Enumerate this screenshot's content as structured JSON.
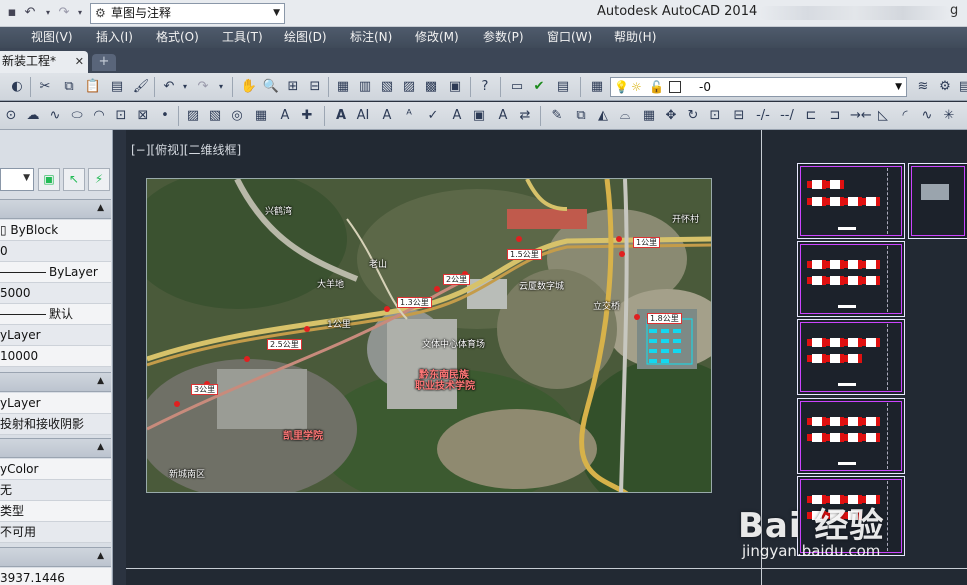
{
  "titlebar": {
    "workspace": "草图与注释",
    "app_title": "Autodesk AutoCAD 2014",
    "trailing": "g"
  },
  "menu": [
    "视图(V)",
    "插入(I)",
    "格式(O)",
    "工具(T)",
    "绘图(D)",
    "标注(N)",
    "修改(M)",
    "参数(P)",
    "窗口(W)",
    "帮助(H)"
  ],
  "tabs": {
    "active": "新装工程*",
    "new_tab_icon": "plus-icon"
  },
  "layer_control": {
    "value": "-0"
  },
  "palette": {
    "rows1": [
      "ByBlock",
      "0",
      "ByLayer",
      "5000",
      "默认",
      "yLayer",
      "10000"
    ],
    "rows2": [
      "yLayer",
      "投射和接收阴影"
    ],
    "rows3": [
      "yColor",
      "无",
      "类型",
      "不可用"
    ],
    "coord": "3937.1446"
  },
  "viewport": {
    "label": "[−][俯视][二维线框]"
  },
  "map": {
    "labels": [
      {
        "t": "兴鹤湾"
      },
      {
        "t": "老山"
      },
      {
        "t": "大羊地"
      },
      {
        "t": "1公里"
      },
      {
        "t": "云厦数字城"
      },
      {
        "t": "文体中心体育场"
      },
      {
        "t": "黔东南民族"
      },
      {
        "t": "职业技术学院"
      },
      {
        "t": "凯里学院"
      },
      {
        "t": "立交桥"
      },
      {
        "t": "开怀村"
      },
      {
        "t": "新城南区"
      }
    ],
    "tags": [
      "1公里",
      "1.5公里",
      "2公里",
      "1.3公里",
      "2.5公里",
      "3公里",
      "1.8公里"
    ]
  },
  "watermark": {
    "brand": "Bai 经验",
    "url": "jingyan.baidu.com"
  }
}
